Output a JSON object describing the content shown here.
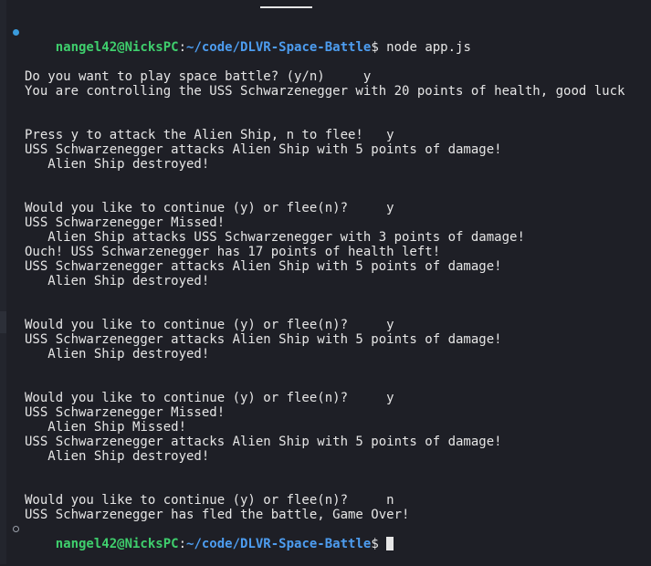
{
  "colors": {
    "background": "#1e1f26",
    "text": "#e6e6e6",
    "user": "#3fcf6d",
    "path": "#4d9df0"
  },
  "prompt": {
    "user_host": "nangel42@NicksPC",
    "separator": ":",
    "path": "~/code/DLVR-Space-Battle",
    "symbol": "$ ",
    "command": "node app.js"
  },
  "output": [
    "Do you want to play space battle? (y/n)     y",
    "You are controlling the USS Schwarzenegger with 20 points of health, good luck",
    "Press y to attack the Alien Ship, n to flee!   y",
    "USS Schwarzenegger attacks Alien Ship with 5 points of damage!",
    "   Alien Ship destroyed!",
    "Would you like to continue (y) or flee(n)?     y",
    "USS Schwarzenegger Missed!",
    "   Alien Ship attacks USS Schwarzenegger with 3 points of damage!",
    "Ouch! USS Schwarzenegger has 17 points of health left!",
    "USS Schwarzenegger attacks Alien Ship with 5 points of damage!",
    "   Alien Ship destroyed!",
    "Would you like to continue (y) or flee(n)?     y",
    "USS Schwarzenegger attacks Alien Ship with 5 points of damage!",
    "   Alien Ship destroyed!",
    "Would you like to continue (y) or flee(n)?     y",
    "USS Schwarzenegger Missed!",
    "   Alien Ship Missed!",
    "USS Schwarzenegger attacks Alien Ship with 5 points of damage!",
    "   Alien Ship destroyed!",
    "Would you like to continue (y) or flee(n)?     n",
    "USS Schwarzenegger has fled the battle, Game Over!"
  ]
}
